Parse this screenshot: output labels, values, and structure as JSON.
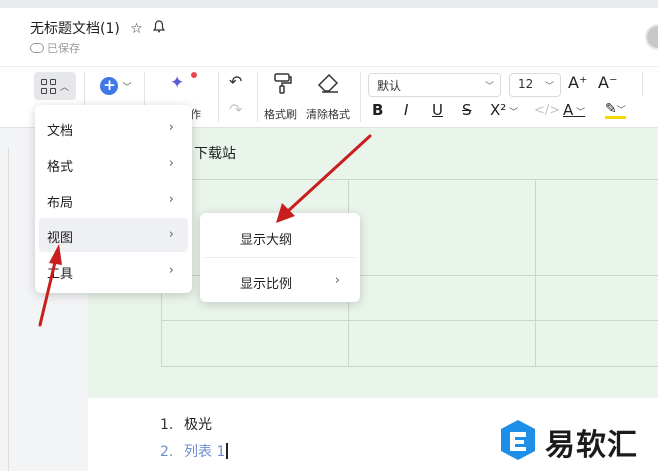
{
  "header": {
    "doc_title": "无标题文档(1)",
    "star_icon": "☆",
    "bell_icon": "🔔",
    "saved_status": "已保存"
  },
  "toolbar": {
    "ai_label_partial": "作",
    "format_painter_label": "格式刷",
    "clear_format_label": "清除格式",
    "font_name": "默认",
    "font_size": "12",
    "bold": "B",
    "italic": "I",
    "underline": "U",
    "strike": "S",
    "superscript": "X²",
    "font_color": "A",
    "font_grow": "A⁺",
    "font_shrink": "A⁻"
  },
  "document": {
    "heading_partial": "下载站",
    "list_items": [
      {
        "num": "1.",
        "text": "极光"
      },
      {
        "num": "2.",
        "text": "列表 1"
      }
    ]
  },
  "app_menu": {
    "items": [
      {
        "label": "文档"
      },
      {
        "label": "格式"
      },
      {
        "label": "布局"
      },
      {
        "label": "视图"
      },
      {
        "label": "工具"
      }
    ]
  },
  "view_submenu": {
    "items": [
      {
        "label": "显示大纲"
      },
      {
        "label": "显示比例"
      }
    ]
  },
  "watermark": {
    "text": "易软汇"
  },
  "colors": {
    "accent_blue": "#3f78e8",
    "arrow_red": "#c81e1e",
    "doc_green": "#e9f4ea"
  }
}
